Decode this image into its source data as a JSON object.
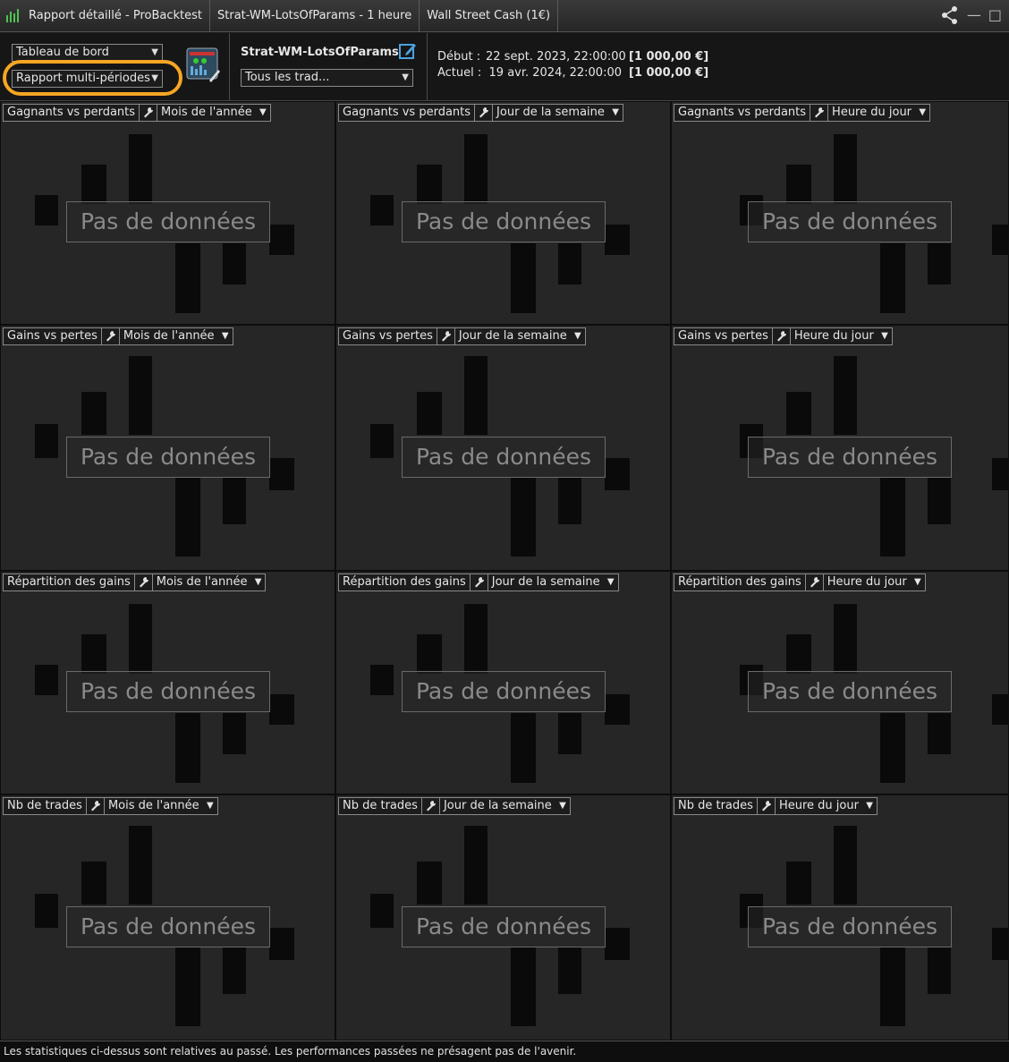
{
  "titlebar": {
    "tab1": "Rapport détaillé - ProBacktest",
    "tab2": "Strat-WM-LotsOfParams - 1 heure",
    "tab3": "Wall Street Cash (1€)"
  },
  "toolbar": {
    "view_select": "Tableau de bord",
    "report_select": "Rapport multi-périodes",
    "strategy_name": "Strat-WM-LotsOfParams",
    "trades_select": "Tous les trad...",
    "start_label": "Début :",
    "start_date": "22 sept. 2023, 22:00:00",
    "start_amount": "[1 000,00 €]",
    "current_label": "Actuel :",
    "current_date": "19 avr. 2024, 22:00:00",
    "current_amount": "[1 000,00 €]"
  },
  "panels": [
    {
      "metric": "Gagnants vs perdants",
      "period": "Mois de l'année",
      "message": "Pas de données"
    },
    {
      "metric": "Gagnants vs perdants",
      "period": "Jour de la semaine",
      "message": "Pas de données"
    },
    {
      "metric": "Gagnants vs perdants",
      "period": "Heure du jour",
      "message": "Pas de données"
    },
    {
      "metric": "Gains vs pertes",
      "period": "Mois de l'année",
      "message": "Pas de données"
    },
    {
      "metric": "Gains vs pertes",
      "period": "Jour de la semaine",
      "message": "Pas de données"
    },
    {
      "metric": "Gains vs pertes",
      "period": "Heure du jour",
      "message": "Pas de données"
    },
    {
      "metric": "Répartition des gains",
      "period": "Mois de l'année",
      "message": "Pas de données"
    },
    {
      "metric": "Répartition des gains",
      "period": "Jour de la semaine",
      "message": "Pas de données"
    },
    {
      "metric": "Répartition des gains",
      "period": "Heure du jour",
      "message": "Pas de données"
    },
    {
      "metric": "Nb de trades",
      "period": "Mois de l'année",
      "message": "Pas de données"
    },
    {
      "metric": "Nb de trades",
      "period": "Jour de la semaine",
      "message": "Pas de données"
    },
    {
      "metric": "Nb de trades",
      "period": "Heure du jour",
      "message": "Pas de données"
    }
  ],
  "footer": {
    "disclaimer": "Les statistiques ci-dessus sont relatives au passé. Les performances passées ne présagent pas de l'avenir."
  },
  "colors": {
    "highlight": "#f5a623",
    "app_icon_green": "#4fc24f",
    "edit_icon_blue": "#4aa3df"
  }
}
